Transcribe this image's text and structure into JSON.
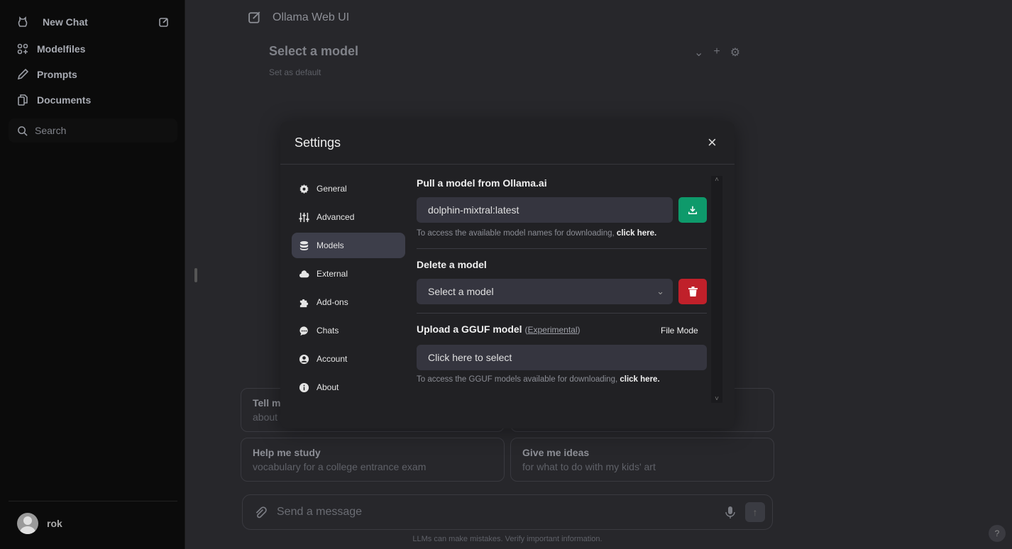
{
  "sidebar": {
    "new_chat": "New Chat",
    "items": [
      {
        "label": "Modelfiles",
        "icon": "modelfiles-icon"
      },
      {
        "label": "Prompts",
        "icon": "pencil-icon"
      },
      {
        "label": "Documents",
        "icon": "documents-icon"
      }
    ],
    "search_placeholder": "Search",
    "user": "rok"
  },
  "header": {
    "title": "Ollama Web UI",
    "model_select": "Select a model",
    "set_default": "Set as default"
  },
  "suggestions": [
    {
      "title": "Tell me",
      "subtitle": "about"
    },
    {
      "title": "",
      "subtitle": ""
    },
    {
      "title": "Help me study",
      "subtitle": "vocabulary for a college entrance exam"
    },
    {
      "title": "Give me ideas",
      "subtitle": "for what to do with my kids' art"
    }
  ],
  "composer": {
    "placeholder": "Send a message",
    "disclaimer": "LLMs can make mistakes. Verify important information.",
    "help": "?"
  },
  "settings": {
    "title": "Settings",
    "close": "×",
    "tabs": [
      "General",
      "Advanced",
      "Models",
      "External",
      "Add-ons",
      "Chats",
      "Account",
      "About"
    ],
    "active_tab": "Models",
    "pull": {
      "heading": "Pull a model from Ollama.ai",
      "value": "dolphin-mixtral:latest",
      "note": "To access the available model names for downloading,",
      "link": "click here."
    },
    "delete": {
      "heading": "Delete a model",
      "select": "Select a model"
    },
    "upload": {
      "heading": "Upload a GGUF model",
      "experimental": "Experimental",
      "mode": "File Mode",
      "button": "Click here to select",
      "note": "To access the GGUF models available for downloading,",
      "link": "click here."
    },
    "colors": {
      "pull_button": "#0e9a6b",
      "delete_button": "#c0202a"
    }
  }
}
